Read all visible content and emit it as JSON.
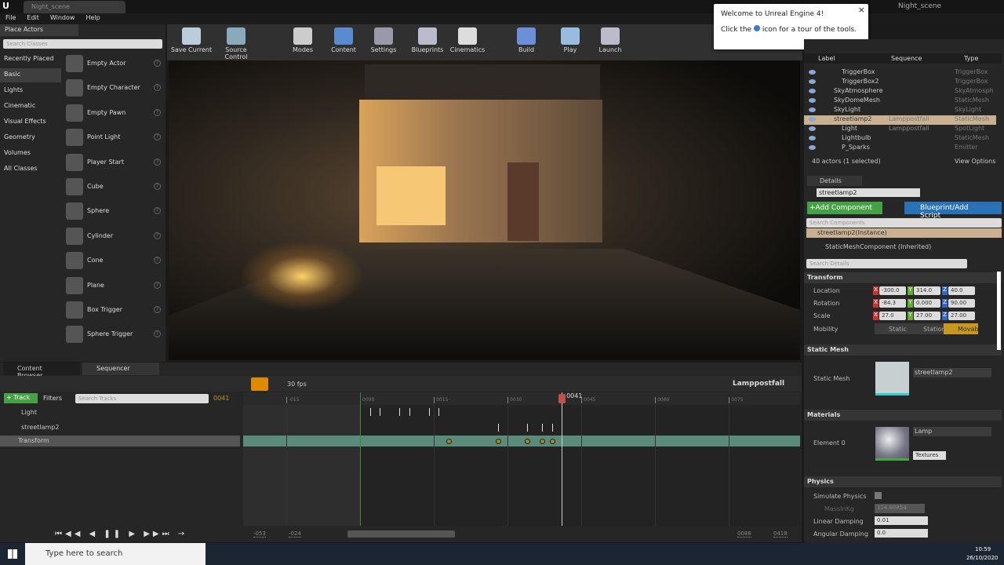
{
  "window": {
    "tab": "Night_scene",
    "project": "Night_scene",
    "menu": [
      "File",
      "Edit",
      "Window",
      "Help"
    ]
  },
  "place_actors": {
    "tab": "Place Actors",
    "search_placeholder": "Search Classes",
    "categories": [
      "Recently Placed",
      "Basic",
      "Lights",
      "Cinematic",
      "Visual Effects",
      "Geometry",
      "Volumes",
      "All Classes"
    ],
    "selected_category": "Basic",
    "actors": [
      "Empty Actor",
      "Empty Character",
      "Empty Pawn",
      "Point Light",
      "Player Start",
      "Cube",
      "Sphere",
      "Cylinder",
      "Cone",
      "Plane",
      "Box Trigger",
      "Sphere Trigger"
    ]
  },
  "toolbar": [
    "Save Current",
    "Source Control",
    "Modes",
    "Content",
    "Settings",
    "Blueprints",
    "Cinematics",
    "Build",
    "Play",
    "Launch"
  ],
  "popup": {
    "title": "Welcome to Unreal Engine 4!",
    "text_before": "Click the",
    "text_after": "icon for a tour of the tools."
  },
  "outliner": {
    "columns": [
      "Label",
      "Sequence",
      "Type"
    ],
    "rows": [
      {
        "label": "TriggerBox",
        "seq": "",
        "type": "TriggerBox",
        "indent": 2
      },
      {
        "label": "TriggerBox2",
        "seq": "",
        "type": "TriggerBox",
        "indent": 2
      },
      {
        "label": "SkyAtmosphere",
        "seq": "",
        "type": "SkyAtmosphere",
        "indent": 1
      },
      {
        "label": "SkyDomeMesh",
        "seq": "",
        "type": "StaticMesh",
        "indent": 1
      },
      {
        "label": "SkyLight",
        "seq": "",
        "type": "SkyLight",
        "indent": 1
      },
      {
        "label": "streetlamp2",
        "seq": "Lamppostfall",
        "type": "StaticMesh",
        "indent": 1,
        "selected": true
      },
      {
        "label": "Light",
        "seq": "Lamppostfall",
        "type": "SpotLight",
        "indent": 2
      },
      {
        "label": "Lightbulb",
        "seq": "",
        "type": "StaticMesh",
        "indent": 2
      },
      {
        "label": "P_Sparks",
        "seq": "",
        "type": "Emitter",
        "indent": 2
      }
    ],
    "status": "40 actors (1 selected)",
    "view_options": "View Options"
  },
  "details": {
    "tab": "Details",
    "name": "streetlamp2",
    "add_component": "+Add Component",
    "blueprint": "Blueprint/Add Script",
    "search_components": "Search Components",
    "instance": "streetlamp2(Instance)",
    "component": "StaticMeshComponent (Inherited)",
    "search_details": "Search Details",
    "transform": {
      "title": "Transform",
      "location": {
        "label": "Location",
        "x": "-300.0",
        "y": "314.0",
        "z": "40.0"
      },
      "rotation": {
        "label": "Rotation",
        "x": "-84.3",
        "y": "0.000",
        "z": "90.00"
      },
      "scale": {
        "label": "Scale",
        "x": "27.0",
        "y": "27.00",
        "z": "27.00"
      },
      "mobility": {
        "label": "Mobility",
        "options": [
          "Static",
          "Station",
          "Movab"
        ],
        "selected": "Movab"
      }
    },
    "static_mesh": {
      "title": "Static Mesh",
      "label": "Static Mesh",
      "value": "streetlamp2"
    },
    "materials": {
      "title": "Materials",
      "label": "Element 0",
      "value": "Lamp",
      "textures": "Textures"
    },
    "physics": {
      "title": "Physics",
      "simulate": "Simulate Physics",
      "mass": "MassInKg",
      "mass_value": "124.80854",
      "linear": "Linear Damping",
      "linear_value": "0.01",
      "angular": "Angular Damping",
      "angular_value": "0.0"
    }
  },
  "sequencer": {
    "tabs": [
      "Content Browser",
      "Sequencer"
    ],
    "fps": "30 fps",
    "sequence": "Lamppostfall",
    "track_btn": "+ Track",
    "filters": "Filters",
    "search_placeholder": "Search Tracks",
    "current_frame": "0041",
    "tracks": [
      "Light",
      "streetlamp2",
      "Transform"
    ],
    "ticks": [
      "-015",
      "0000",
      "0015",
      "0030",
      "0045",
      "0060",
      "0075"
    ],
    "playhead": 41,
    "light_keys": [
      2,
      4,
      8,
      10,
      14,
      16
    ],
    "streetlamp_keys": [
      28,
      34,
      37,
      39
    ],
    "transform_keys": [
      18,
      28,
      34,
      37,
      39
    ],
    "range": [
      "-053",
      "-024",
      "0088",
      "0418"
    ]
  },
  "taskbar": {
    "search": "Type here to search",
    "time": "10:59",
    "date": "26/10/2020"
  }
}
